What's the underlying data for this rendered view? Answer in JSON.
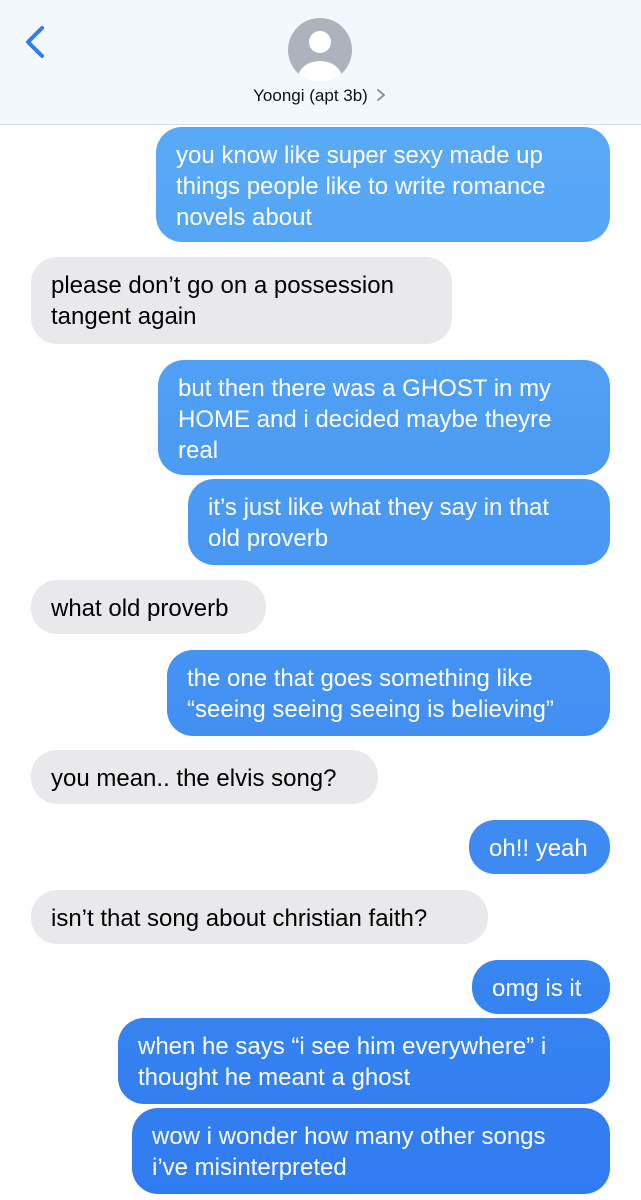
{
  "header": {
    "contact_name": "Yoongi (apt 3b)"
  },
  "icons": {
    "back": "chevron-left-icon",
    "avatar": "person-silhouette-icon",
    "contact_chevron": "chevron-right-icon"
  },
  "colors": {
    "sent_top": "#5eb0f7",
    "sent_bottom": "#2f7bf0",
    "received": "#e9e9eb",
    "header_bg": "#f3f8fd",
    "accent": "#2f7bf0"
  },
  "messages": [
    {
      "sender": "me",
      "text": "you know like super sexy made up\nthings people like to write romance\nnovels about"
    },
    {
      "sender": "them",
      "text": "please don’t go on a possession\ntangent again"
    },
    {
      "sender": "me",
      "text": "but then there was a GHOST in my\nHOME and i decided maybe theyre\nreal"
    },
    {
      "sender": "me",
      "text": "it’s just like what they say in that\nold proverb"
    },
    {
      "sender": "them",
      "text": "what old proverb"
    },
    {
      "sender": "me",
      "text": "the one that goes something like\n“seeing seeing seeing is believing”"
    },
    {
      "sender": "them",
      "text": "you mean.. the elvis song?"
    },
    {
      "sender": "me",
      "text": "oh!! yeah"
    },
    {
      "sender": "them",
      "text": "isn’t that song about christian faith?"
    },
    {
      "sender": "me",
      "text": "omg is it"
    },
    {
      "sender": "me",
      "text": "when he says “i see him everywhere” i\nthought he meant a ghost"
    },
    {
      "sender": "me",
      "text": "wow i wonder how many other songs\ni’ve misinterpreted"
    }
  ]
}
